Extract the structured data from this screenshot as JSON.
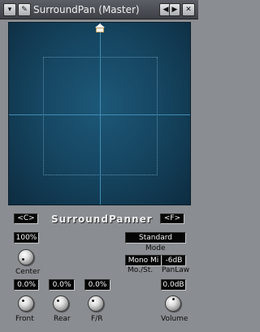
{
  "window": {
    "title": "SurroundPan (Master)",
    "menu_icon": "chevron-down-icon",
    "edit_icon": "edit-icon",
    "prev_icon": "triangle-left-icon",
    "next_icon": "triangle-right-icon",
    "close_icon": "close-icon"
  },
  "panner": {
    "front_speaker_icon": "speaker-home-icon",
    "grid_color": "#3f8db4",
    "background_color": "#164763"
  },
  "controls": {
    "brand": "SurroundPanner",
    "center_button": "<C>",
    "f_button": "<F>",
    "center_value": "100%",
    "center_label": "Center",
    "mode_value": "Standard",
    "mode_label": "Mode",
    "mono_stereo_value": "Mono Mi",
    "mono_stereo_label": "Mo./St.",
    "panlaw_value": "-6dB",
    "panlaw_label": "PanLaw",
    "front_value": "0.0%",
    "front_label": "Front",
    "rear_value": "0.0%",
    "rear_label": "Rear",
    "fr_value": "0.0%",
    "fr_label": "F/R",
    "volume_value": "0.0dB",
    "volume_label": "Volume"
  },
  "colors": {
    "panel": "#8a8d91",
    "titlebar": "#4a4d52",
    "lcd_bg": "#050505",
    "lcd_text": "#f4f4f4"
  }
}
